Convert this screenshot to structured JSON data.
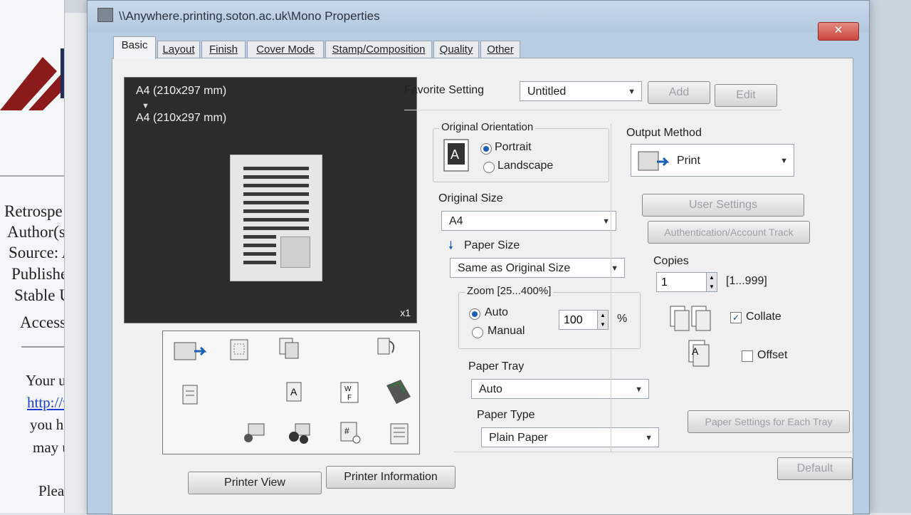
{
  "background_document": {
    "lines": [
      "Retrospe",
      "Author(s",
      "Source: A",
      "Publishec",
      "Stable UR",
      "Accessed:",
      "Your use of",
      "http://www",
      "you have ob",
      "may use co",
      "Please cont"
    ]
  },
  "dialog": {
    "title": "\\\\Anywhere.printing.soton.ac.uk\\Mono Properties",
    "close": "✕",
    "tabs": [
      "Basic",
      "Layout",
      "Finish",
      "Cover Mode",
      "Stamp/Composition",
      "Quality",
      "Other"
    ]
  },
  "preview": {
    "original_size": "A4 (210x297 mm)",
    "output_size": "A4 (210x297 mm)",
    "copies_indicator": "x1"
  },
  "buttons": {
    "printer_view": "Printer View",
    "printer_information": "Printer Information",
    "add": "Add",
    "edit": "Edit",
    "user_settings": "User Settings",
    "authentication": "Authentication/Account Track",
    "paper_settings": "Paper Settings for Each Tray",
    "default": "Default"
  },
  "favorite": {
    "label": "Favorite Setting",
    "value": "Untitled"
  },
  "orientation": {
    "title": "Original Orientation",
    "portrait": "Portrait",
    "landscape": "Landscape",
    "selected": "Portrait"
  },
  "original_size": {
    "label": "Original Size",
    "value": "A4"
  },
  "paper_size": {
    "label": "Paper Size",
    "value": "Same as Original Size"
  },
  "zoom": {
    "title": "Zoom [25...400%]",
    "auto": "Auto",
    "manual": "Manual",
    "value": "100",
    "unit": "%"
  },
  "paper_tray": {
    "label": "Paper Tray",
    "value": "Auto"
  },
  "paper_type": {
    "label": "Paper Type",
    "value": "Plain Paper"
  },
  "output": {
    "label": "Output Method",
    "value": "Print"
  },
  "copies": {
    "label": "Copies",
    "value": "1",
    "range": "[1...999]",
    "collate": "Collate",
    "offset": "Offset"
  },
  "colors": {
    "accent": "#1b5fb8",
    "dialog_frame": "#b9cde2",
    "preview_bg": "#2c2c2c"
  }
}
